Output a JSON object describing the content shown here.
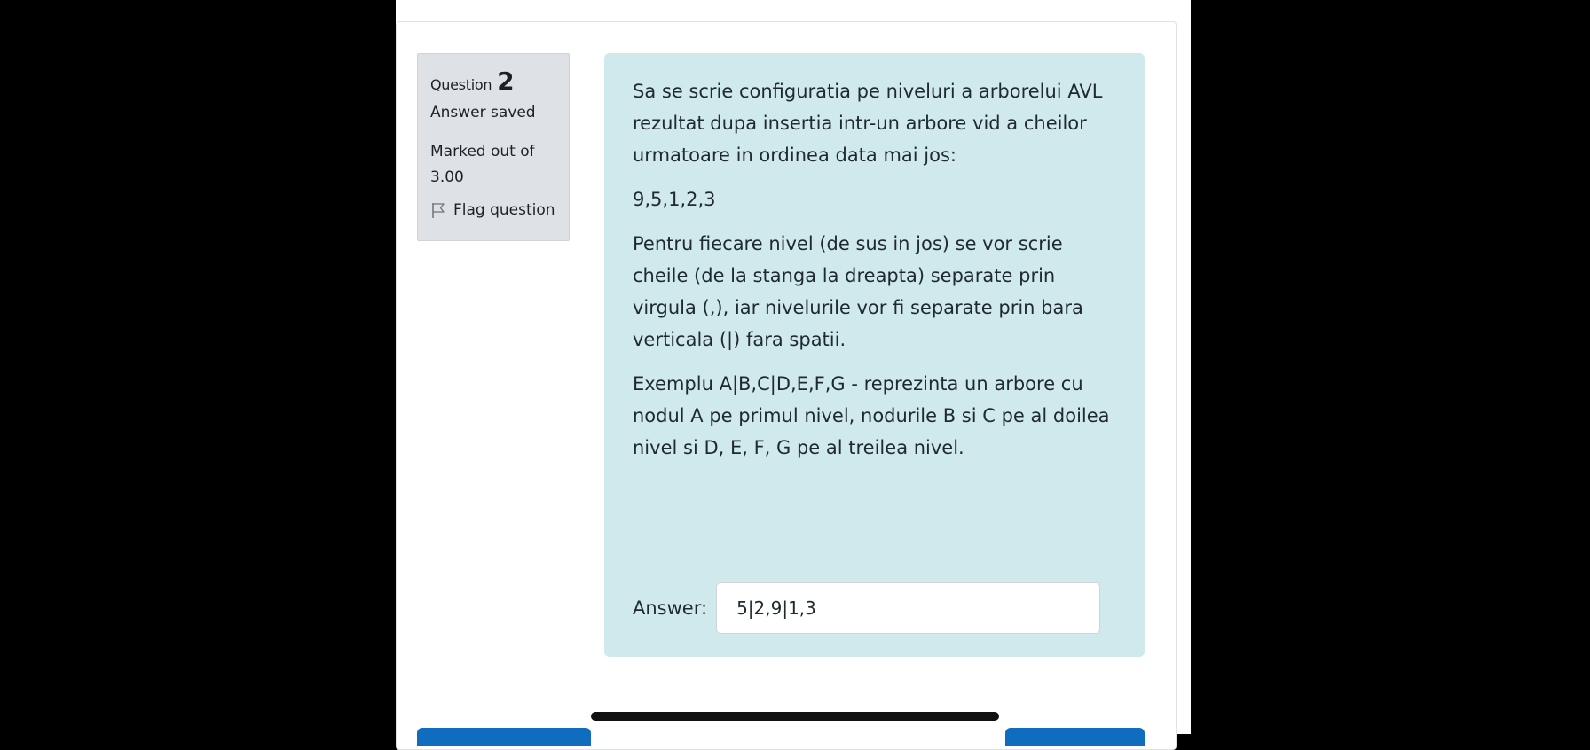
{
  "question_info": {
    "label": "Question",
    "number": "2",
    "state": "Answer saved",
    "grade": "Marked out of 3.00",
    "flag_label": "Flag question",
    "flag_icon": "flag-icon"
  },
  "question_text": {
    "paragraphs": [
      "Sa se scrie configuratia pe niveluri a arborelui AVL rezultat dupa insertia intr-un arbore vid a cheilor urmatoare in ordinea data mai jos:",
      "9,5,1,2,3",
      "Pentru fiecare nivel (de sus in jos) se vor scrie cheile (de la stanga la dreapta) separate prin virgula (,), iar nivelurile vor fi separate prin bara verticala (|) fara spatii.",
      "Exemplu A|B,C|D,E,F,G - reprezinta un arbore cu nodul A pe primul nivel, nodurile B si C pe al doilea nivel si D, E, F, G pe al treilea nivel."
    ]
  },
  "answer": {
    "label": "Answer:",
    "value": "5|2,9|1,3"
  },
  "colors": {
    "formulation_bg": "#cfe9ed",
    "info_bg": "#dee2e6",
    "primary_button": "#0f6cbf"
  }
}
